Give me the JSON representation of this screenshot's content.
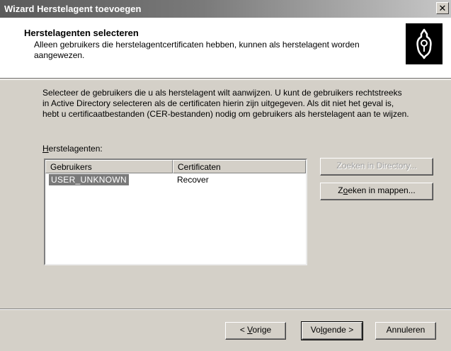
{
  "window": {
    "title": "Wizard Herstelagent toevoegen"
  },
  "header": {
    "title": "Herstelagenten selecteren",
    "subtitle": "Alleen gebruikers die herstelagentcertificaten hebben, kunnen als herstelagent worden aangewezen.",
    "icon": "key-icon"
  },
  "main": {
    "intro": "Selecteer de gebruikers die u als herstelagent wilt aanwijzen. U kunt de gebruikers rechtstreeks in Active Directory selecteren als de certificaten hierin zijn uitgegeven. Als dit niet het geval is, hebt u certificaatbestanden (CER-bestanden) nodig om gebruikers als herstelagent aan te wijzen.",
    "list_label_first": "H",
    "list_label_rest": "erstelagenten:",
    "columns": [
      "Gebruikers",
      "Certificaten"
    ],
    "rows": [
      {
        "user": "USER_UNKNOWN",
        "certificate": "Recover"
      }
    ],
    "buttons": {
      "find_directory": "Zoeken in Directory...",
      "find_folders_pre": "Z",
      "find_folders_u": "o",
      "find_folders_post": "eken in mappen..."
    }
  },
  "footer": {
    "back_pre": "< ",
    "back_u": "V",
    "back_post": "orige",
    "next_pre": "Vo",
    "next_u": "l",
    "next_post": "gende >",
    "cancel": "Annuleren"
  },
  "colors": {
    "selection": "#7a7a7a",
    "face": "#d4d0c8"
  }
}
